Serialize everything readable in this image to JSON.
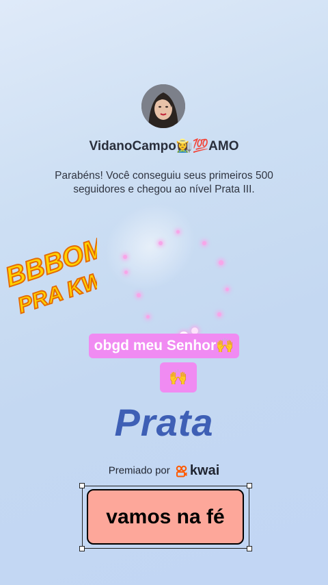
{
  "profile": {
    "username": "VidanoCampo👩‍🌾💯AMO",
    "avatar_label": "profile photo"
  },
  "announcement": {
    "message": "Parabéns! Você conseguiu seus primeiros 500 seguidores e chegou ao nível Prata III."
  },
  "sticker": {
    "line1": "BBBOM",
    "line2": "PRA KWAI"
  },
  "caption": {
    "line1": "obgd meu Senhor🙌",
    "line2": "🙌"
  },
  "tier": {
    "name": "Prata"
  },
  "sponsor": {
    "prefix": "Premiado por",
    "brand": "kwai"
  },
  "text_overlay": {
    "label": "vamos na fé"
  },
  "colors": {
    "pink_caption": "#f08bf2",
    "tier_text": "#3e5fb5",
    "overlay_fill": "#fda79a",
    "sticker_fill": "#ffd400",
    "sticker_outline": "#e56b00",
    "kwai_brand": "#ff5a00"
  }
}
